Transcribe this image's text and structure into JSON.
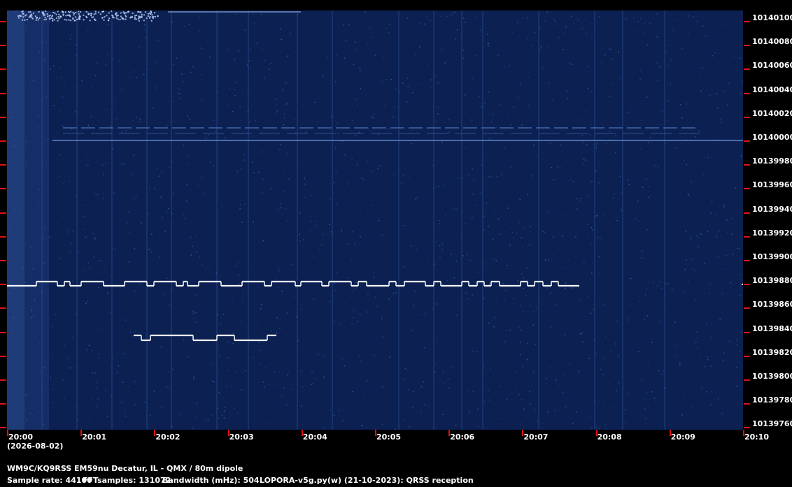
{
  "date_label": "(2026-08-02)",
  "time_labels": [
    "20:00",
    "20:01",
    "20:02",
    "20:03",
    "20:04",
    "20:05",
    "20:06",
    "20:07",
    "20:08",
    "20:09",
    "20:10"
  ],
  "freq_labels": [
    "10140100",
    "10140080",
    "10140060",
    "10140040",
    "10140020",
    "10140000",
    "10139980",
    "10139960",
    "10139940",
    "10139920",
    "10139900",
    "10139880",
    "10139860",
    "10139840",
    "10139820",
    "10139800",
    "10139780",
    "10139760"
  ],
  "info": {
    "station": "WM9C/KQ9RSS EM59nu Decatur, IL - QMX / 80m dipole",
    "sample_rate": "Sample rate: 44100",
    "fft_samples": "FFTsamples: 131072",
    "bandwidth": "Bandwidth (mHz): 504",
    "software": "LOPORA-v5g.py(w) (21-10-2023): QRSS reception"
  },
  "colors": {
    "background": "#0c2152",
    "tick": "#e01010",
    "signal": "#ffffff"
  }
}
